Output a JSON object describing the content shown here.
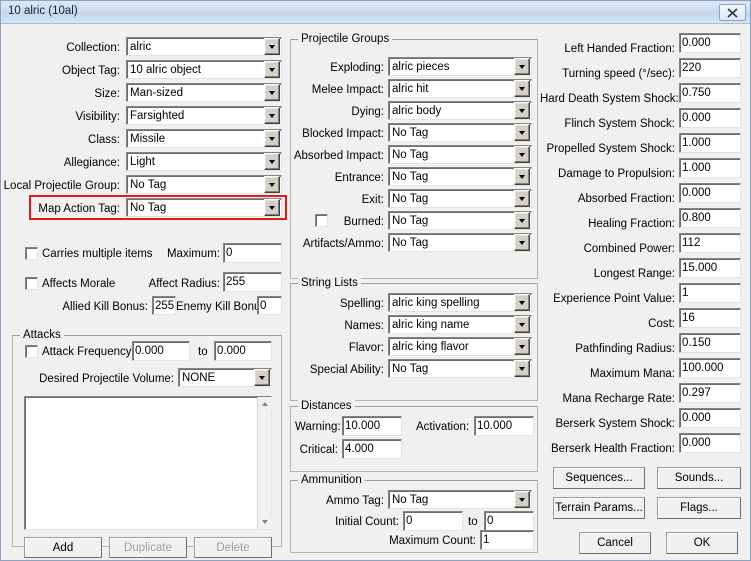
{
  "window": {
    "title": "10 alric (10al)",
    "close_icon": "close-icon",
    "highlight_color": "#e01b1b"
  },
  "left_column": {
    "combos": [
      {
        "label": "Collection:",
        "value": "alric"
      },
      {
        "label": "Object Tag:",
        "value": "10 alric object"
      },
      {
        "label": "Size:",
        "value": "Man-sized"
      },
      {
        "label": "Visibility:",
        "value": "Farsighted"
      },
      {
        "label": "Class:",
        "value": "Missile"
      },
      {
        "label": "Allegiance:",
        "value": "Light"
      },
      {
        "label": "Local Projectile Group:",
        "value": "No Tag"
      },
      {
        "label": "Map Action Tag:",
        "value": "No Tag"
      }
    ],
    "carries_multiple_items": {
      "label": "Carries multiple items",
      "checked": false
    },
    "maximum": {
      "label": "Maximum:",
      "value": "0"
    },
    "affects_morale": {
      "label": "Affects Morale",
      "checked": false
    },
    "affect_radius": {
      "label": "Affect Radius:",
      "value": "255"
    },
    "allied_kill_bonus": {
      "label": "Allied Kill Bonus:",
      "value": "255"
    },
    "enemy_kill_bonus": {
      "label": "Enemy Kill Bonus:",
      "value": "0"
    },
    "attacks": {
      "caption": "Attacks",
      "attack_frequency": {
        "label": "Attack Frequency",
        "checked": false,
        "from": "0.000",
        "to_label": "to",
        "to": "0.000"
      },
      "desired_projectile_volume": {
        "label": "Desired Projectile Volume:",
        "value": "NONE"
      },
      "list_items": [],
      "buttons": [
        {
          "label": "Add",
          "disabled": false
        },
        {
          "label": "Duplicate",
          "disabled": true
        },
        {
          "label": "Delete",
          "disabled": true
        }
      ]
    }
  },
  "projectile_groups": {
    "caption": "Projectile Groups",
    "rows": [
      {
        "label": "Exploding:",
        "value": "alric pieces"
      },
      {
        "label": "Melee Impact:",
        "value": "alric hit"
      },
      {
        "label": "Dying:",
        "value": "alric body"
      },
      {
        "label": "Blocked Impact:",
        "value": "No Tag"
      },
      {
        "label": "Absorbed Impact:",
        "value": "No Tag"
      },
      {
        "label": "Entrance:",
        "value": "No Tag"
      },
      {
        "label": "Exit:",
        "value": "No Tag"
      },
      {
        "label": "Burned:",
        "value": "No Tag",
        "checkbox": true,
        "checked": false
      },
      {
        "label": "Artifacts/Ammo:",
        "value": "No Tag"
      }
    ]
  },
  "string_lists": {
    "caption": "String Lists",
    "rows": [
      {
        "label": "Spelling:",
        "value": "alric king spelling"
      },
      {
        "label": "Names:",
        "value": "alric king name"
      },
      {
        "label": "Flavor:",
        "value": "alric king flavor"
      },
      {
        "label": "Special Ability:",
        "value": "No Tag"
      }
    ]
  },
  "distances": {
    "caption": "Distances",
    "warning": {
      "label": "Warning:",
      "value": "10.000"
    },
    "activation": {
      "label": "Activation:",
      "value": "10.000"
    },
    "critical": {
      "label": "Critical:",
      "value": "4.000"
    }
  },
  "ammunition": {
    "caption": "Ammunition",
    "ammo_tag": {
      "label": "Ammo Tag:",
      "value": "No Tag"
    },
    "initial_count": {
      "label": "Initial Count:",
      "value": "0",
      "to_label": "to",
      "to": "0"
    },
    "maximum_count": {
      "label": "Maximum Count:",
      "value": "1"
    }
  },
  "right_column": {
    "fields": [
      {
        "label": "Left Handed Fraction:",
        "value": "0.000"
      },
      {
        "label": "Turning speed (°/sec):",
        "value": "220"
      },
      {
        "label": "Hard Death System Shock:",
        "value": "0.750"
      },
      {
        "label": "Flinch System Shock:",
        "value": "0.000"
      },
      {
        "label": "Propelled System Shock:",
        "value": "1.000"
      },
      {
        "label": "Damage to Propulsion:",
        "value": "1.000"
      },
      {
        "label": "Absorbed Fraction:",
        "value": "0.000"
      },
      {
        "label": "Healing Fraction:",
        "value": "0.800"
      },
      {
        "label": "Combined Power:",
        "value": "112"
      },
      {
        "label": "Longest Range:",
        "value": "15.000"
      },
      {
        "label": "Experience Point Value:",
        "value": "1"
      },
      {
        "label": "Cost:",
        "value": "16"
      },
      {
        "label": "Pathfinding Radius:",
        "value": "0.150"
      },
      {
        "label": "Maximum Mana:",
        "value": "100.000"
      },
      {
        "label": "Mana Recharge Rate:",
        "value": "0.297"
      },
      {
        "label": "Berserk System Shock:",
        "value": "0.000"
      },
      {
        "label": "Berserk Health Fraction:",
        "value": "0.000"
      }
    ],
    "buttons": [
      {
        "label": "Sequences..."
      },
      {
        "label": "Sounds..."
      },
      {
        "label": "Terrain Params..."
      },
      {
        "label": "Flags..."
      }
    ],
    "cancel": "Cancel",
    "ok": "OK"
  }
}
